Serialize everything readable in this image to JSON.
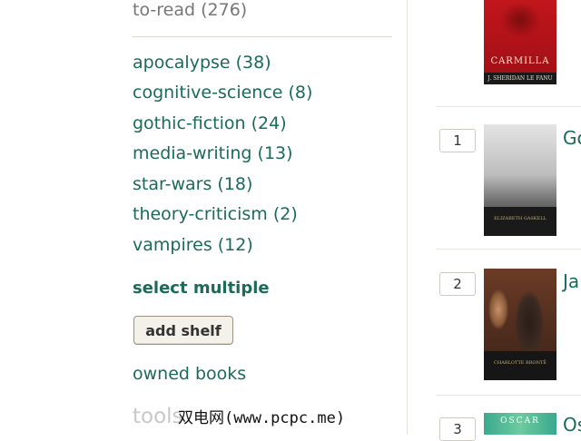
{
  "sidebar": {
    "to_read": "to-read (276)",
    "shelves": [
      "apocalypse (38)",
      "cognitive-science (8)",
      "gothic-fiction (24)",
      "media-writing (13)",
      "star-wars (18)",
      "theory-criticism (2)",
      "vampires (12)"
    ],
    "select_multiple": "select multiple",
    "add_shelf": "add shelf",
    "owned_books": "owned books",
    "tools": "tools"
  },
  "books": [
    {
      "rank": "",
      "cover_title": "CARMILLA",
      "cover_author": "J. SHERIDAN LE FANU",
      "title": ""
    },
    {
      "rank": "1",
      "cover_title": "",
      "cover_author": "ELIZABETH GASKELL",
      "title": "Go"
    },
    {
      "rank": "2",
      "cover_title": "",
      "cover_author": "CHARLOTTE BRONTË",
      "title": "Ja"
    },
    {
      "rank": "3",
      "cover_title": "OSCAR",
      "cover_author": "",
      "title": "Os"
    }
  ],
  "watermark": "双电网(www.pcpc.me)",
  "colors": {
    "link": "#1b6a5a",
    "muted": "#767676",
    "button_bg": "#f4f1ea"
  }
}
